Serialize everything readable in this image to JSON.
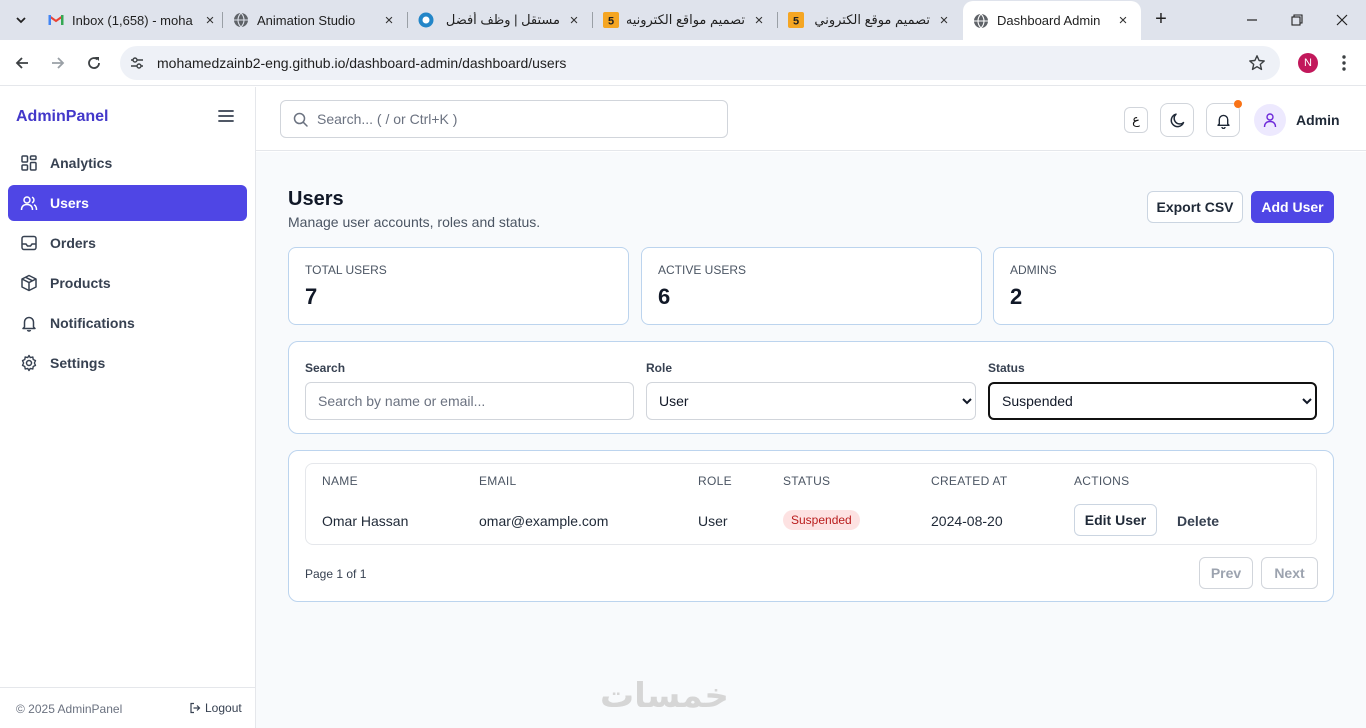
{
  "browser": {
    "tabs": [
      {
        "title": "Inbox (1,658) - moha",
        "icon": "gmail-icon"
      },
      {
        "title": "Animation Studio",
        "icon": "globe-icon"
      },
      {
        "title": "مستقل | وظف أفضل ا",
        "icon": "mostaql-icon"
      },
      {
        "title": "تصميم مواقع الكترونيه",
        "icon": "khamsat-icon"
      },
      {
        "title": "تصميم موقع الكتروني",
        "icon": "khamsat-icon"
      },
      {
        "title": "Dashboard Admin",
        "icon": "globe-icon",
        "active": true
      }
    ],
    "url": "mohamedzainb2-eng.github.io/dashboard-admin/dashboard/users",
    "profile_initial": "N"
  },
  "sidebar": {
    "brand": "AdminPanel",
    "items": [
      {
        "label": "Analytics",
        "icon": "grid-icon"
      },
      {
        "label": "Users",
        "icon": "users-icon",
        "active": true
      },
      {
        "label": "Orders",
        "icon": "inbox-icon"
      },
      {
        "label": "Products",
        "icon": "box-icon"
      },
      {
        "label": "Notifications",
        "icon": "bell-icon"
      },
      {
        "label": "Settings",
        "icon": "gear-icon"
      }
    ],
    "footer": {
      "copyright": "© 2025 AdminPanel",
      "logout": "Logout"
    }
  },
  "header": {
    "search_placeholder": "Search... ( / or Ctrl+K )",
    "lang_label": "ع",
    "user_name": "Admin"
  },
  "page": {
    "title": "Users",
    "subtitle": "Manage user accounts, roles and status.",
    "export_label": "Export CSV",
    "add_label": "Add User"
  },
  "stats": [
    {
      "label": "TOTAL USERS",
      "value": "7"
    },
    {
      "label": "ACTIVE USERS",
      "value": "6"
    },
    {
      "label": "ADMINS",
      "value": "2"
    }
  ],
  "filters": {
    "search_label": "Search",
    "search_placeholder": "Search by name or email...",
    "role_label": "Role",
    "role_value": "User",
    "status_label": "Status",
    "status_value": "Suspended"
  },
  "table": {
    "columns": [
      "NAME",
      "EMAIL",
      "ROLE",
      "STATUS",
      "CREATED AT",
      "ACTIONS"
    ],
    "rows": [
      {
        "name": "Omar Hassan",
        "email": "omar@example.com",
        "role": "User",
        "status": "Suspended",
        "created": "2024-08-20",
        "edit_label": "Edit User",
        "delete_label": "Delete"
      }
    ]
  },
  "pagination": {
    "info": "Page 1 of 1",
    "prev": "Prev",
    "next": "Next"
  },
  "watermark": "خمسات",
  "colors": {
    "accent": "#4f46e5",
    "brand_text": "#4338ca",
    "danger_bg": "#fde2e2",
    "danger_text": "#b91c1c",
    "notif_dot": "#f97316"
  }
}
